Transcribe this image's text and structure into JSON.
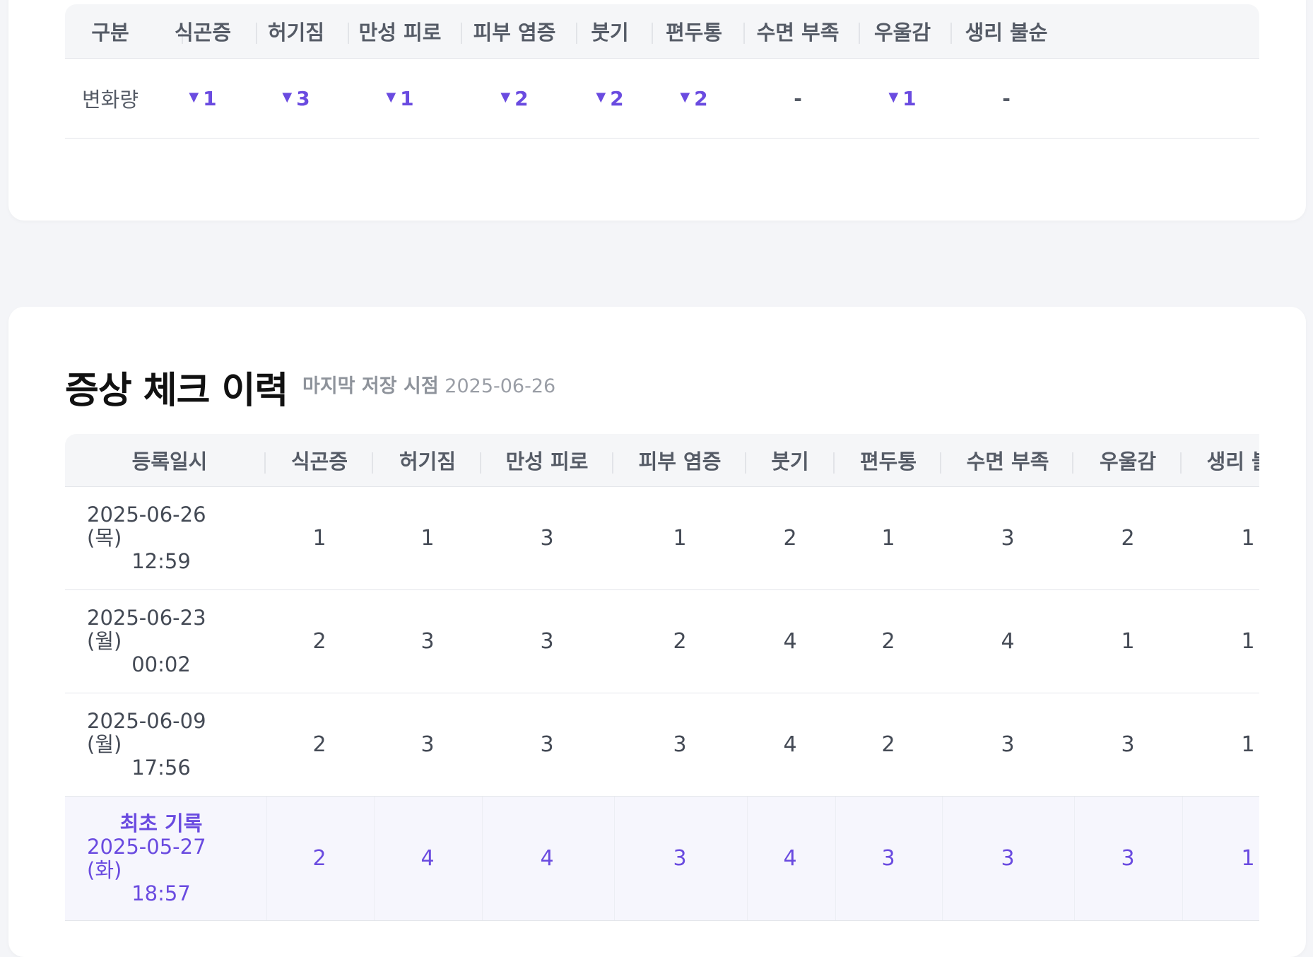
{
  "summary": {
    "headers": [
      "구분",
      "식곤증",
      "허기짐",
      "만성 피로",
      "피부 염증",
      "붓기",
      "편두통",
      "수면 부족",
      "우울감",
      "생리 불순"
    ],
    "row_label": "변화량",
    "changes": [
      {
        "value": "1",
        "direction": "down"
      },
      {
        "value": "3",
        "direction": "down"
      },
      {
        "value": "1",
        "direction": "down"
      },
      {
        "value": "2",
        "direction": "down"
      },
      {
        "value": "2",
        "direction": "down"
      },
      {
        "value": "2",
        "direction": "down"
      },
      {
        "value": "-",
        "direction": "none"
      },
      {
        "value": "1",
        "direction": "down"
      },
      {
        "value": "-",
        "direction": "none"
      }
    ],
    "down_symbol": "▼"
  },
  "history": {
    "title": "증상 체크 이력",
    "last_saved_label": "마지막 저장 시점",
    "last_saved_date": "2025-06-26",
    "headers": [
      "등록일시",
      "식곤증",
      "허기짐",
      "만성 피로",
      "피부 염증",
      "붓기",
      "편두통",
      "수면 부족",
      "우울감",
      "생리 불순"
    ],
    "rows": [
      {
        "first_label": "",
        "date": "2025-06-26 (목)",
        "time": "12:59",
        "values": [
          "1",
          "1",
          "3",
          "1",
          "2",
          "1",
          "3",
          "2",
          "1"
        ]
      },
      {
        "first_label": "",
        "date": "2025-06-23 (월)",
        "time": "00:02",
        "values": [
          "2",
          "3",
          "3",
          "2",
          "4",
          "2",
          "4",
          "1",
          "1"
        ]
      },
      {
        "first_label": "",
        "date": "2025-06-09 (월)",
        "time": "17:56",
        "values": [
          "2",
          "3",
          "3",
          "3",
          "4",
          "2",
          "3",
          "3",
          "1"
        ]
      },
      {
        "first_label": "최초 기록",
        "date": "2025-05-27 (화)",
        "time": "18:57",
        "values": [
          "2",
          "4",
          "4",
          "3",
          "4",
          "3",
          "3",
          "3",
          "1"
        ]
      }
    ]
  },
  "colors": {
    "accent": "#6a4be0",
    "header_bg": "#f5f6f8",
    "first_row_bg": "#f6f6fd",
    "page_bg": "#f4f5f8"
  }
}
